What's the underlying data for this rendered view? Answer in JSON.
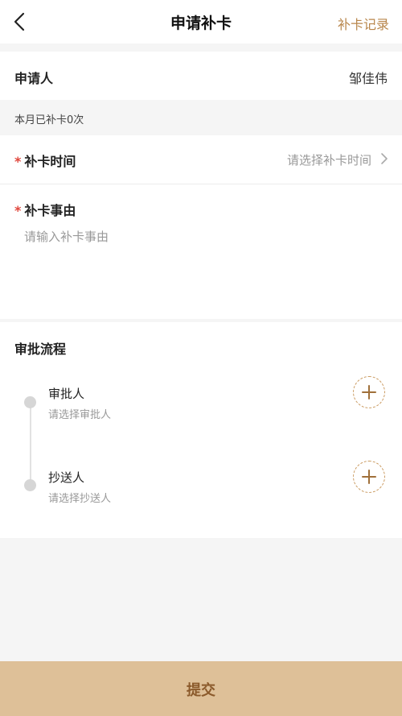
{
  "header": {
    "title": "申请补卡",
    "record_link": "补卡记录"
  },
  "applicant": {
    "label": "申请人",
    "value": "邹佳伟"
  },
  "monthly_notice": "本月已补卡0次",
  "required_mark": "*",
  "makeup_time": {
    "label": "补卡时间",
    "placeholder": "请选择补卡时间"
  },
  "makeup_reason": {
    "label": "补卡事由",
    "placeholder": "请输入补卡事由"
  },
  "approval_flow": {
    "title": "审批流程",
    "steps": [
      {
        "title": "审批人",
        "subtitle": "请选择审批人"
      },
      {
        "title": "抄送人",
        "subtitle": "请选择抄送人"
      }
    ]
  },
  "submit_label": "提交",
  "colors": {
    "accent": "#b8864b",
    "submit_bg": "#dec098",
    "submit_text": "#8b5a2b",
    "required": "#e0463c"
  }
}
